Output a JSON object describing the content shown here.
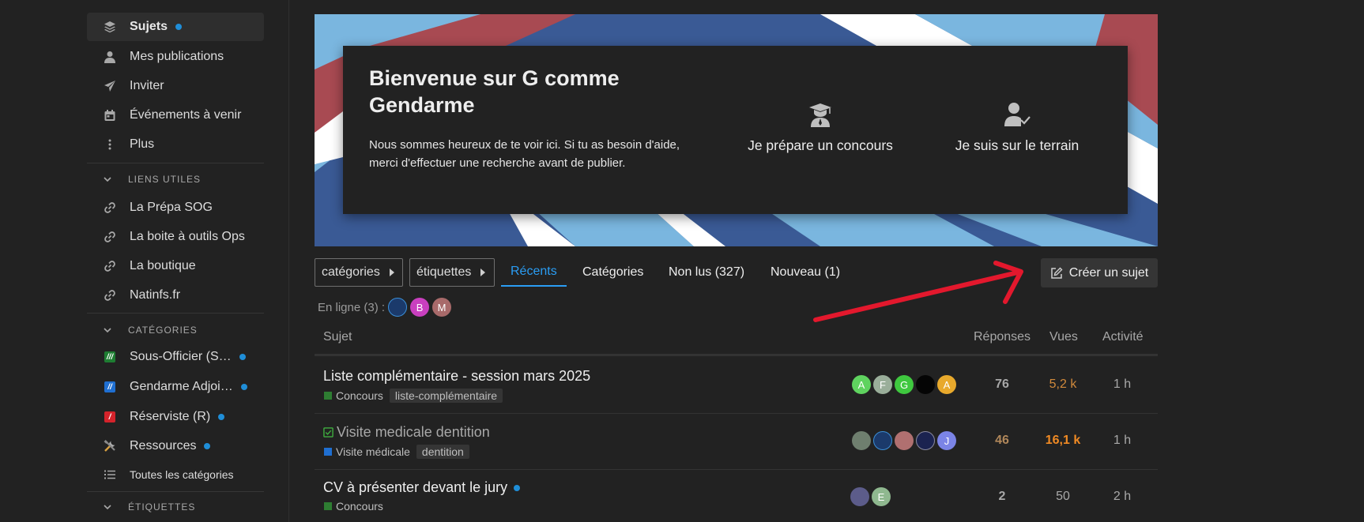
{
  "sidebar": {
    "nav": [
      {
        "label": "Sujets",
        "icon": "layers-icon",
        "active": true,
        "dot": true
      },
      {
        "label": "Mes publications",
        "icon": "user-icon"
      },
      {
        "label": "Inviter",
        "icon": "paper-plane-icon"
      },
      {
        "label": "Événements à venir",
        "icon": "calendar-icon"
      },
      {
        "label": "Plus",
        "icon": "vertical-ellipsis-icon"
      }
    ],
    "links_header": "LIENS UTILES",
    "links": [
      {
        "label": "La Prépa SOG",
        "icon": "link-icon"
      },
      {
        "label": "La boite à outils Ops",
        "icon": "link-icon"
      },
      {
        "label": "La boutique",
        "icon": "link-icon"
      },
      {
        "label": "Natinfs.fr",
        "icon": "link-icon"
      }
    ],
    "categories_header": "CATÉGORIES",
    "categories": [
      {
        "label": "Sous-Officier (S…",
        "badge": "///",
        "color": "#1e7d32",
        "dot": true
      },
      {
        "label": "Gendarme Adjoi…",
        "badge": "//",
        "color": "#1f6fd1",
        "dot": true
      },
      {
        "label": "Réserviste (R)",
        "badge": "/",
        "color": "#d4232b",
        "dot": true
      },
      {
        "label": "Ressources",
        "icon": "tools-icon",
        "dot": true
      },
      {
        "label": "Toutes les catégories",
        "icon": "list-icon"
      }
    ],
    "tags_header": "ÉTIQUETTES"
  },
  "welcome": {
    "title": "Bienvenue sur G comme Gendarme",
    "text": "Nous sommes heureux de te voir ici. Si tu as besoin d'aide, merci d'effectuer une recherche avant de publier.",
    "link1": {
      "label": "Je prépare un concours",
      "icon": "graduate-icon"
    },
    "link2": {
      "label": "Je suis sur le terrain",
      "icon": "user-check-icon"
    }
  },
  "nav": {
    "categories_dropdown": "catégories",
    "tags_dropdown": "étiquettes",
    "tabs": [
      "Récents",
      "Catégories",
      "Non lus (327)",
      "Nouveau (1)"
    ],
    "create": "Créer un sujet"
  },
  "online": {
    "label": "En ligne (3) :",
    "users": [
      {
        "letter": "",
        "color": "#1b3a6b"
      },
      {
        "letter": "B",
        "color": "#c93fbf"
      },
      {
        "letter": "M",
        "color": "#a86a6a"
      }
    ]
  },
  "table": {
    "headers": {
      "topic": "Sujet",
      "replies": "Réponses",
      "views": "Vues",
      "activity": "Activité"
    },
    "rows": [
      {
        "title": "Liste complémentaire - session mars 2025",
        "category": "Concours",
        "cat_color": "#2e7d32",
        "tags": [
          "liste-complémentaire"
        ],
        "posters": [
          {
            "letter": "A",
            "color": "#5fd35f"
          },
          {
            "letter": "F",
            "color": "#9aae9a"
          },
          {
            "letter": "G",
            "color": "#3fc83f"
          },
          {
            "letter": "",
            "color": "#050505"
          },
          {
            "letter": "A",
            "color": "#e8a92c"
          }
        ],
        "replies": "76",
        "views": "5,2 k",
        "activity": "1 h"
      },
      {
        "title": "Visite medicale dentition",
        "category": "Visite médicale",
        "cat_color": "#1f6fd1",
        "tags": [
          "dentition"
        ],
        "posters": [
          {
            "letter": "",
            "color": "#6f7f6f"
          },
          {
            "letter": "",
            "color": "#1b3a6b"
          },
          {
            "letter": "",
            "color": "#b07070"
          },
          {
            "letter": "",
            "color": "#1b2350"
          },
          {
            "letter": "J",
            "color": "#7b84e6"
          }
        ],
        "replies": "46",
        "views": "16,1 k",
        "activity": "1 h"
      },
      {
        "title": "CV à présenter devant le jury",
        "category": "Concours",
        "cat_color": "#2e7d32",
        "tags": [],
        "posters": [
          {
            "letter": "",
            "color": "#5c5c8a"
          },
          {
            "letter": "E",
            "color": "#8fb88f"
          }
        ],
        "replies": "2",
        "views": "50",
        "activity": "2 h"
      }
    ]
  },
  "colors": {
    "accent": "#2a9df4",
    "arrow": "#e3182d",
    "hot_views": "#f08a24"
  }
}
